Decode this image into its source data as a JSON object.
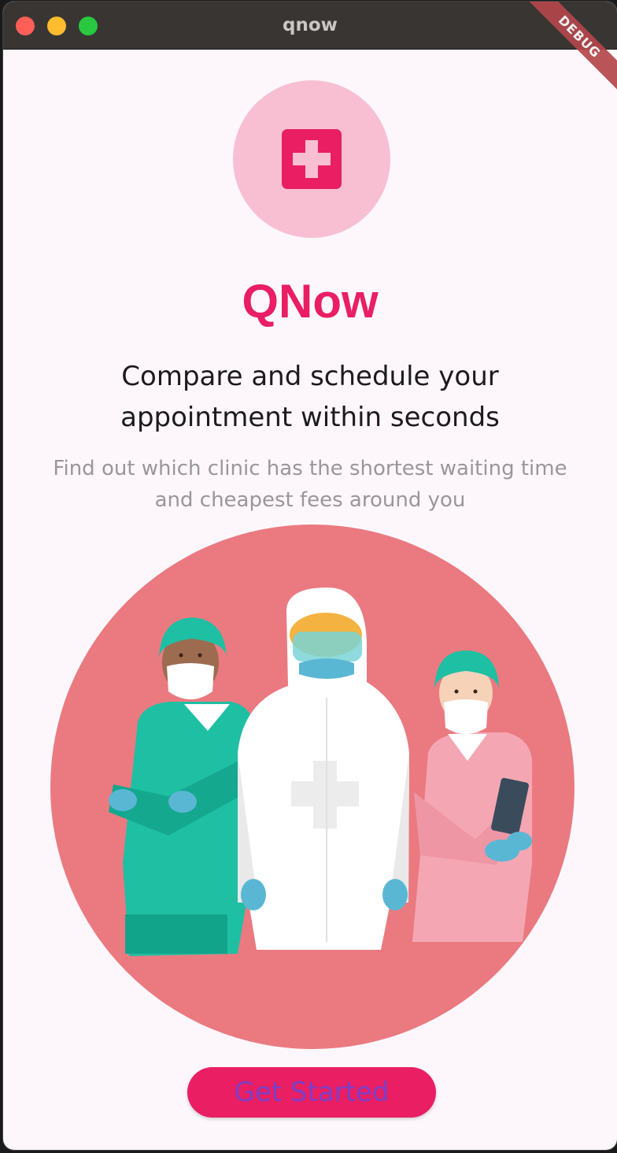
{
  "window": {
    "title": "qnow",
    "debug_label": "DEBUG"
  },
  "logo": {
    "icon": "medical-cross-icon",
    "circle_color": "#f8bfd2",
    "icon_color": "#e91e63"
  },
  "main": {
    "app_title": "QNow",
    "headline": "Compare and schedule your appointment within seconds",
    "subtext": "Find out which clinic has the shortest waiting time and cheapest fees around you"
  },
  "illustration": {
    "icon": "medical-staff-illustration",
    "background_color": "#ea7a80"
  },
  "cta": {
    "label": "Get Started",
    "background_color": "#e91e63",
    "text_color": "#7c3fc6"
  }
}
